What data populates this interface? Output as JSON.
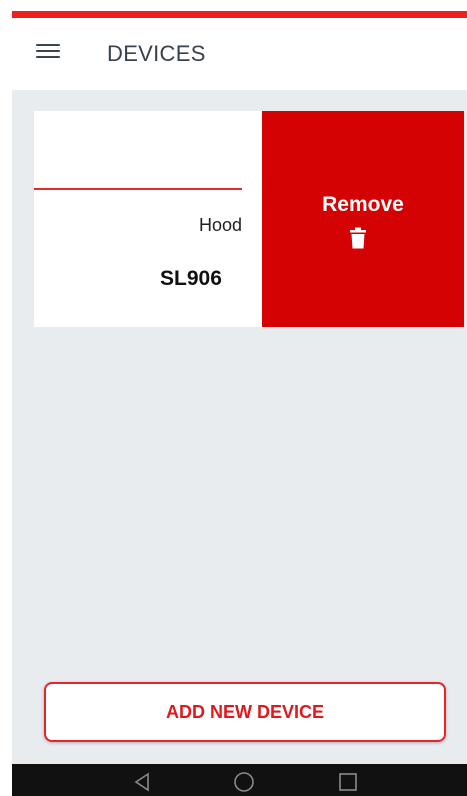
{
  "header": {
    "title": "DEVICES",
    "menu_icon": "hamburger-menu-icon"
  },
  "devices": [
    {
      "type": "Hood",
      "name": "SL906",
      "remove_label": "Remove",
      "remove_icon": "trash-icon"
    }
  ],
  "actions": {
    "add_device_label": "ADD NEW DEVICE"
  },
  "system_nav": {
    "back_icon": "back-triangle-icon",
    "home_icon": "home-circle-icon",
    "recents_icon": "recents-square-icon"
  },
  "colors": {
    "accent_red": "#d40202",
    "status_red": "#ef1f1f",
    "background_grey": "#e9ecef",
    "title_text": "#37424c"
  }
}
